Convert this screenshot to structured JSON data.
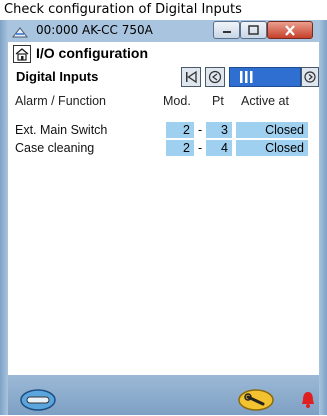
{
  "caption": "Check configuration of Digital Inputs",
  "window": {
    "title": "00:000 AK-CC 750A"
  },
  "screen": {
    "title": "I/O configuration",
    "section": "Digital Inputs"
  },
  "columns": {
    "function": "Alarm / Function",
    "module": "Mod.",
    "point": "Pt",
    "active": "Active at"
  },
  "rows": [
    {
      "label": "Ext. Main Switch",
      "module": "2",
      "sep": "-",
      "point": "3",
      "active": "Closed"
    },
    {
      "label": "Case cleaning",
      "module": "2",
      "sep": "-",
      "point": "4",
      "active": "Closed"
    }
  ],
  "icons": {
    "app": "app-icon",
    "home": "home-icon",
    "first": "first-page-icon",
    "prev": "previous-page-icon",
    "next": "next-page-icon",
    "menu": "menu-capsule-icon",
    "service": "wrench-icon",
    "alarm": "alarm-bell-icon"
  },
  "colors": {
    "window_frame": "#a8c4df",
    "value_cell": "#9fd0f0",
    "scroll_thumb": "#2f6fd1",
    "alarm": "#e02020",
    "service_button": "#f2c230"
  }
}
